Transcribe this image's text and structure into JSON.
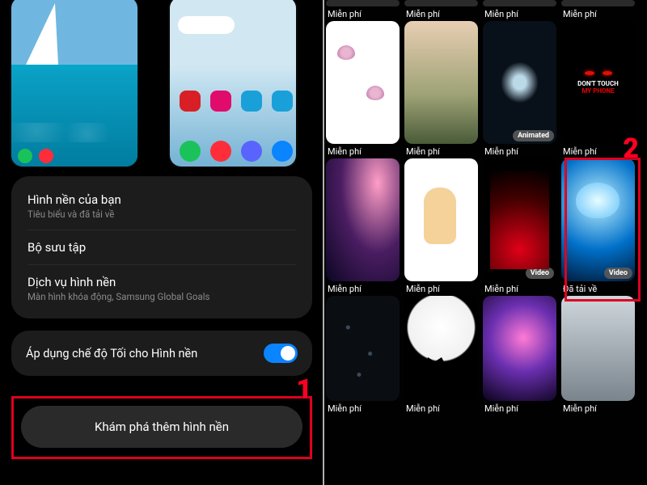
{
  "left": {
    "options": [
      {
        "title": "Hình nền của bạn",
        "sub": "Tiêu biểu và đã tải về"
      },
      {
        "title": "Bộ sưu tập",
        "sub": ""
      },
      {
        "title": "Dịch vụ hình nền",
        "sub": "Màn hình khóa động, Samsung Global Goals"
      }
    ],
    "dark_mode_label": "Áp dụng chế độ Tối cho Hình nền",
    "dark_mode_on": true,
    "explore_button": "Khám phá thêm hình nền",
    "step1": "1",
    "lock_dots": [
      "#19c35a",
      "#ff2d3a"
    ],
    "home_top": [
      "#d81f26",
      "#e10b6b",
      "#1aa0d8",
      "#1aa0d8"
    ],
    "home_dock": [
      "#19c35a",
      "#ff2d3a",
      "#5964ff",
      "#0a84ff"
    ]
  },
  "right": {
    "step2": "2",
    "badge_animated": "Animated",
    "badge_video": "Video",
    "row0": [
      {
        "cap": "Miễn phí"
      },
      {
        "cap": "Miễn phí"
      },
      {
        "cap": "Miễn phí"
      },
      {
        "cap": "Miễn phí"
      }
    ],
    "row1": [
      {
        "cap": "Miễn phí",
        "art": "t-butter"
      },
      {
        "cap": "Miễn phí",
        "art": "t-land"
      },
      {
        "cap": "Miễn phí",
        "art": "t-anim",
        "badge": "Animated"
      },
      {
        "cap": "Miễn phí",
        "art": "t-dtouch"
      }
    ],
    "dtouch_l1": "DON'T TOUCH",
    "dtouch_l2": "MY PHONE",
    "row2": [
      {
        "cap": "Miễn phí",
        "art": "t-galaxy"
      },
      {
        "cap": "Miễn phí",
        "art": "t-toon"
      },
      {
        "cap": "Miễn phí",
        "art": "t-red",
        "badge": "Video"
      },
      {
        "cap": "Đã tải về",
        "art": "t-jelly",
        "badge": "Video"
      }
    ],
    "row3": [
      {
        "cap": "Miễn phí",
        "art": "t-rain"
      },
      {
        "cap": "Miễn phí",
        "art": "t-wolf"
      },
      {
        "cap": "Miễn phí",
        "art": "t-neb"
      },
      {
        "cap": "Miễn phí",
        "art": "t-grey"
      }
    ]
  }
}
